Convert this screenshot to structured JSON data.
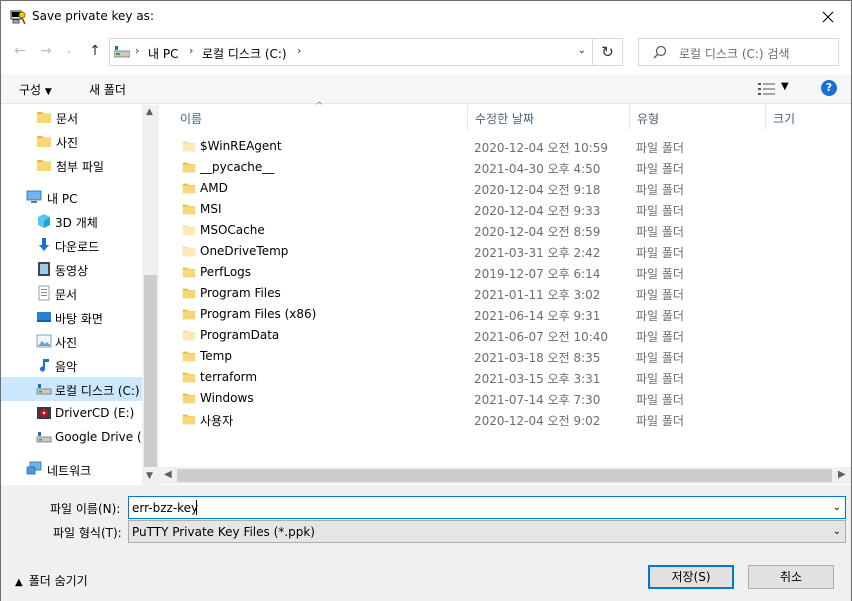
{
  "window": {
    "title": "Save private key as:"
  },
  "address": {
    "crumbs": [
      "내 PC",
      "로컬 디스크 (C:)"
    ]
  },
  "search": {
    "placeholder": "로컬 디스크 (C:) 검색"
  },
  "toolbar": {
    "organize": "구성",
    "new_folder": "새 폴더",
    "help": "?"
  },
  "nav": [
    {
      "label": "문서",
      "icon": "folder-icon"
    },
    {
      "label": "사진",
      "icon": "folder-icon"
    },
    {
      "label": "첨부 파일",
      "icon": "folder-icon"
    },
    {
      "label": "내 PC",
      "icon": "computer-icon"
    },
    {
      "label": "3D 개체",
      "icon": "cube-icon"
    },
    {
      "label": "다운로드",
      "icon": "download-icon"
    },
    {
      "label": "동영상",
      "icon": "video-icon"
    },
    {
      "label": "문서",
      "icon": "document-icon"
    },
    {
      "label": "바탕 화면",
      "icon": "desktop-icon"
    },
    {
      "label": "사진",
      "icon": "picture-icon"
    },
    {
      "label": "음악",
      "icon": "music-icon"
    },
    {
      "label": "로컬 디스크 (C:)",
      "icon": "drive-icon"
    },
    {
      "label": "DriverCD (E:)",
      "icon": "cd-drive-icon"
    },
    {
      "label": "Google Drive (G:)",
      "icon": "drive-icon"
    },
    {
      "label": "네트워크",
      "icon": "network-icon"
    }
  ],
  "columns": {
    "name": "이름",
    "date": "수정한 날짜",
    "type": "유형",
    "size": "크기"
  },
  "files": [
    {
      "name": "$WinREAgent",
      "date": "2020-12-04 오전 10:59",
      "type": "파일 폴더",
      "faded": true
    },
    {
      "name": "__pycache__",
      "date": "2021-04-30 오후 4:50",
      "type": "파일 폴더",
      "faded": false
    },
    {
      "name": "AMD",
      "date": "2020-12-04 오전 9:18",
      "type": "파일 폴더",
      "faded": false
    },
    {
      "name": "MSI",
      "date": "2020-12-04 오전 9:33",
      "type": "파일 폴더",
      "faded": false
    },
    {
      "name": "MSOCache",
      "date": "2020-12-04 오전 8:59",
      "type": "파일 폴더",
      "faded": true
    },
    {
      "name": "OneDriveTemp",
      "date": "2021-03-31 오후 2:42",
      "type": "파일 폴더",
      "faded": true
    },
    {
      "name": "PerfLogs",
      "date": "2019-12-07 오후 6:14",
      "type": "파일 폴더",
      "faded": false
    },
    {
      "name": "Program Files",
      "date": "2021-01-11 오후 3:02",
      "type": "파일 폴더",
      "faded": false
    },
    {
      "name": "Program Files (x86)",
      "date": "2021-06-14 오후 9:31",
      "type": "파일 폴더",
      "faded": false
    },
    {
      "name": "ProgramData",
      "date": "2021-06-07 오전 10:40",
      "type": "파일 폴더",
      "faded": true
    },
    {
      "name": "Temp",
      "date": "2021-03-18 오전 8:35",
      "type": "파일 폴더",
      "faded": false
    },
    {
      "name": "terraform",
      "date": "2021-03-15 오후 3:31",
      "type": "파일 폴더",
      "faded": false
    },
    {
      "name": "Windows",
      "date": "2021-07-14 오후 7:30",
      "type": "파일 폴더",
      "faded": false
    },
    {
      "name": "사용자",
      "date": "2020-12-04 오전 9:02",
      "type": "파일 폴더",
      "faded": false
    }
  ],
  "form": {
    "filename_label": "파일 이름(N):",
    "filename_value": "err-bzz-key",
    "filetype_label": "파일 형식(T):",
    "filetype_value": "PuTTY Private Key Files (*.ppk)",
    "hide_folders": "폴더 숨기기",
    "save": "저장(S)",
    "cancel": "취소"
  },
  "colors": {
    "accent": "#0078d7",
    "folder": "#f8d775",
    "selected": "#cce8ff"
  }
}
